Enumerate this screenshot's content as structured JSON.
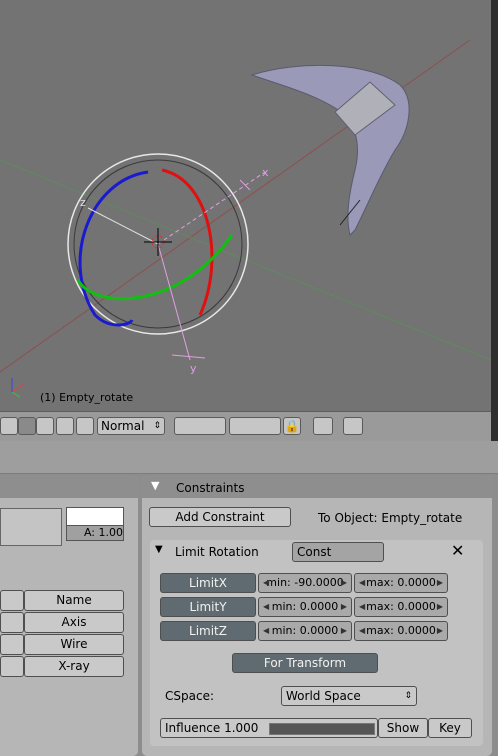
{
  "viewport": {
    "object_label": "(1) Empty_rotate",
    "axis_labels": {
      "x": "x",
      "y": "y",
      "z": "z"
    }
  },
  "header": {
    "mode_value": "Normal"
  },
  "left_panel": {
    "alpha_label": "A: 1.00",
    "draw_buttons": [
      "Name",
      "Axis",
      "Wire",
      "X-ray"
    ]
  },
  "constraints": {
    "title": "Constraints",
    "add_constraint_label": "Add Constraint",
    "to_object_label": "To Object: Empty_rotate",
    "limit_rotation": {
      "title": "Limit Rotation",
      "name_value": "Const",
      "rows": [
        {
          "toggle": "LimitX",
          "min": "min: -90.0000",
          "max": "max: 0.0000"
        },
        {
          "toggle": "LimitY",
          "min": "min: 0.0000",
          "max": "max: 0.0000"
        },
        {
          "toggle": "LimitZ",
          "min": "min: 0.0000",
          "max": "max: 0.0000"
        }
      ],
      "for_transform_label": "For Transform",
      "cspace_label": "CSpace:",
      "cspace_value": "World Space",
      "influence_label": "Influence 1.000",
      "influence_fraction": 1.0,
      "show_label": "Show",
      "key_label": "Key"
    }
  },
  "colors": {
    "viewport_bg": "#737373",
    "panel_bg": "#b6b6b6",
    "toggle_dark": "#5f6b70"
  }
}
